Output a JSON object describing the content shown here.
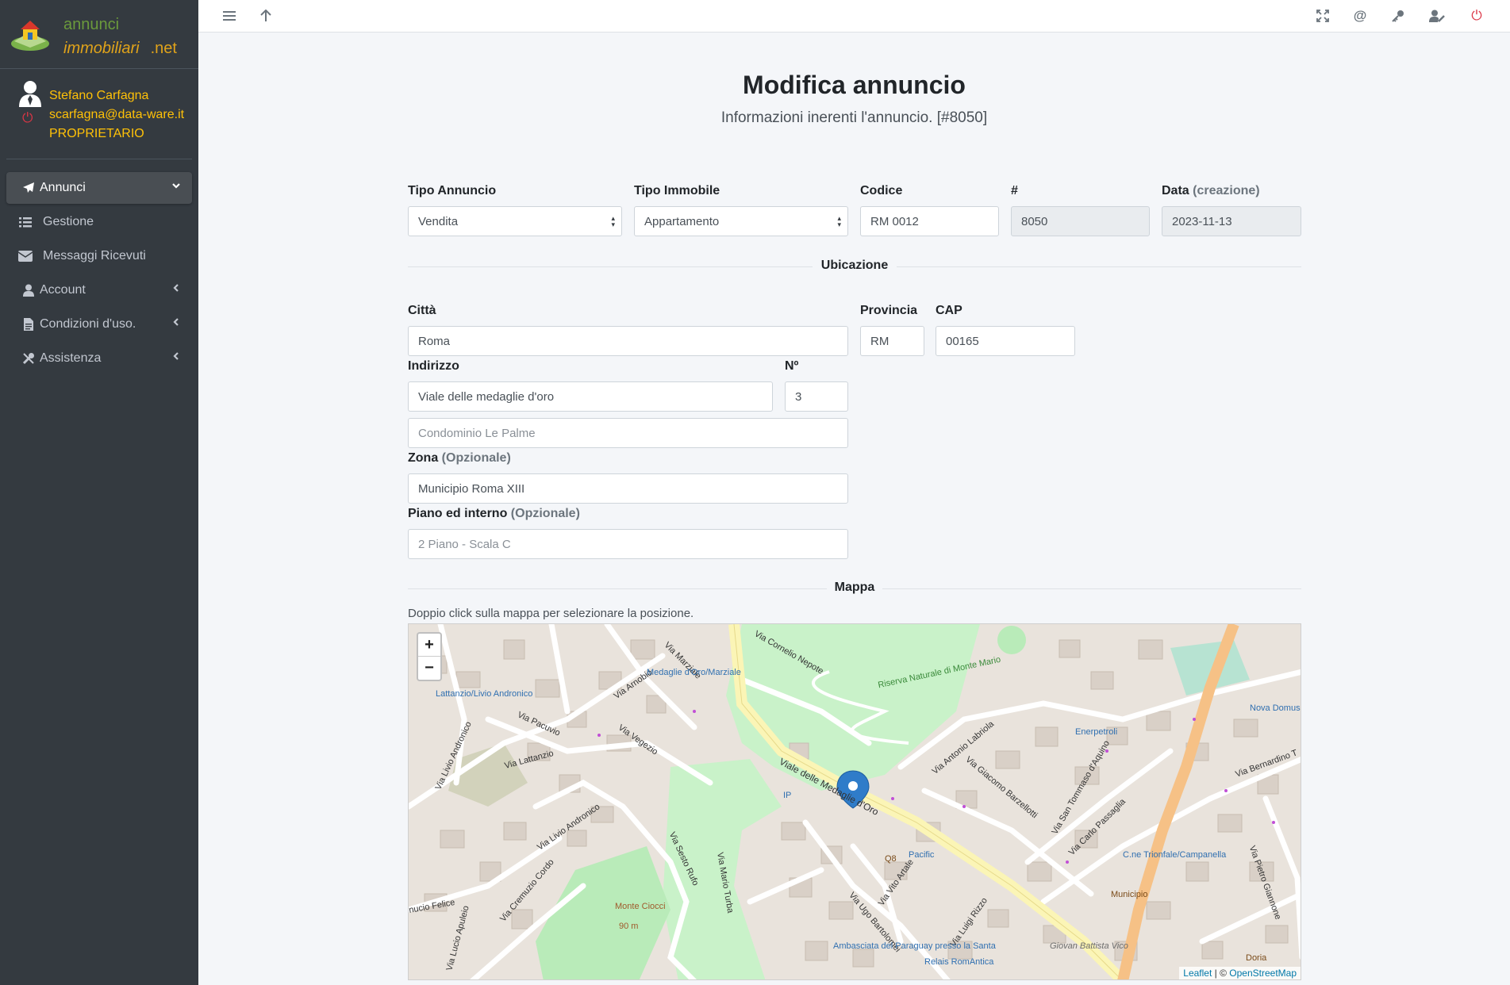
{
  "brand": {
    "line1": "annunci",
    "line2": "immobiliari",
    "line3": ".net"
  },
  "user": {
    "name": "Stefano Carfagna",
    "email": "scarfagna@data-ware.it",
    "role": "PROPRIETARIO"
  },
  "sidebar": {
    "items": [
      {
        "label": "Annunci",
        "icon": "paper-plane-icon",
        "active": true
      },
      {
        "label": "Gestione",
        "icon": "list-icon"
      },
      {
        "label": "Messaggi Ricevuti",
        "icon": "envelope-icon"
      },
      {
        "label": "Account",
        "icon": "user-icon"
      },
      {
        "label": "Condizioni d'uso.",
        "icon": "document-icon"
      },
      {
        "label": "Assistenza",
        "icon": "tools-icon"
      }
    ]
  },
  "topbar": {
    "icons": [
      "menu-icon",
      "arrow-up-icon",
      "fullscreen-icon",
      "at-icon",
      "key-icon",
      "user-edit-icon",
      "power-icon"
    ]
  },
  "page": {
    "title": "Modifica annuncio",
    "subtitle": "Informazioni inerenti l'annuncio. [#8050]"
  },
  "form": {
    "tipo_annuncio": {
      "label": "Tipo Annuncio",
      "value": "Vendita"
    },
    "tipo_immobile": {
      "label": "Tipo Immobile",
      "value": "Appartamento"
    },
    "codice": {
      "label": "Codice",
      "value": "RM 0012"
    },
    "id": {
      "label": "#",
      "value": "8050"
    },
    "data": {
      "label": "Data",
      "label_opt": "(creazione)",
      "value": "2023-11-13"
    },
    "section_ubicazione": "Ubicazione",
    "citta": {
      "label": "Città",
      "value": "Roma"
    },
    "provincia": {
      "label": "Provincia",
      "value": "RM"
    },
    "cap": {
      "label": "CAP",
      "value": "00165"
    },
    "indirizzo": {
      "label": "Indirizzo",
      "value": "Viale delle medaglie d'oro"
    },
    "numero": {
      "label": "Nº",
      "value": "3"
    },
    "indirizzo2": {
      "placeholder": "Condominio Le Palme"
    },
    "zona": {
      "label": "Zona",
      "label_opt": "(Opzionale)",
      "value": "Municipio Roma XIII"
    },
    "piano": {
      "label": "Piano ed interno",
      "label_opt": "(Opzionale)",
      "placeholder": "2 Piano - Scala C"
    },
    "section_mappa": "Mappa",
    "map_hint": "Doppio click sulla mappa per selezionare la posizione."
  },
  "map": {
    "zoom_in": "+",
    "zoom_out": "−",
    "attribution": {
      "leaflet": "Leaflet",
      "sep": " | © ",
      "osm": "OpenStreetMap"
    },
    "labels": {
      "viale": "Viale delle Medaglie d'Oro",
      "via_lattanzio": "Via Lattanzio",
      "via_pacuvio": "Via Pacuvio",
      "via_vegezio": "Via Vegezio",
      "via_arnobio": "Via Arnobio",
      "via_marziale": "Via Marziale",
      "via_livio_andronico": "Via Livio Andronico",
      "via_sesto_rufo": "Via Sesto Rufo",
      "via_mario_turba": "Via Mario Turba",
      "via_cornelio_nepote": "Via Cornelio Nepote",
      "riserva": "Riserva Naturale di Monte Mario",
      "via_antonio_labriola": "Via Antonio Labriola",
      "via_giacomo_barzellotti": "Via Giacomo Barzellotti",
      "via_san_tommaso": "Via San Tommaso d'Aquino",
      "via_carlo_passaglia": "Via Carlo Passaglia",
      "via_bernardino": "Via Bernardino T",
      "via_pietro_giannone": "Via Pietro Giannone",
      "via_vito_artale": "Via Vito Artale",
      "via_ugo_bartolomei": "Via Ugo Bartolomei",
      "via_luigi_rizzo": "Via Luigi Rizzo",
      "via_cremuzio_cordo": "Via Cremuzio Cordo",
      "via_lucio_apuleio": "Via Lucio Apuleio",
      "nucio_felice": "nucio Felice",
      "monte_ciocci": "Monte Ciocci",
      "monte_ciocci_alt": "90 m",
      "lattanzio_stop": "Lattanzio/Livio Andronico",
      "medaglie_stop": "Medaglie d'Oro/Marziale",
      "nova_domus": "Nova Domus",
      "enerpetroli": "Enerpetroli",
      "pacific": "Pacific",
      "c_ne_trionfale": "C.ne Trionfale/Campanella",
      "municipio": "Municipio",
      "ambasciata": "Ambasciata del Paraguay presso la Santa",
      "relais": "Relais RomAntica",
      "giovan_battista": "Giovan Battista Vico",
      "doria": "Doria",
      "via_marziale_sm": "Via Marziale",
      "q8": "Q8",
      "ip": "IP"
    }
  }
}
